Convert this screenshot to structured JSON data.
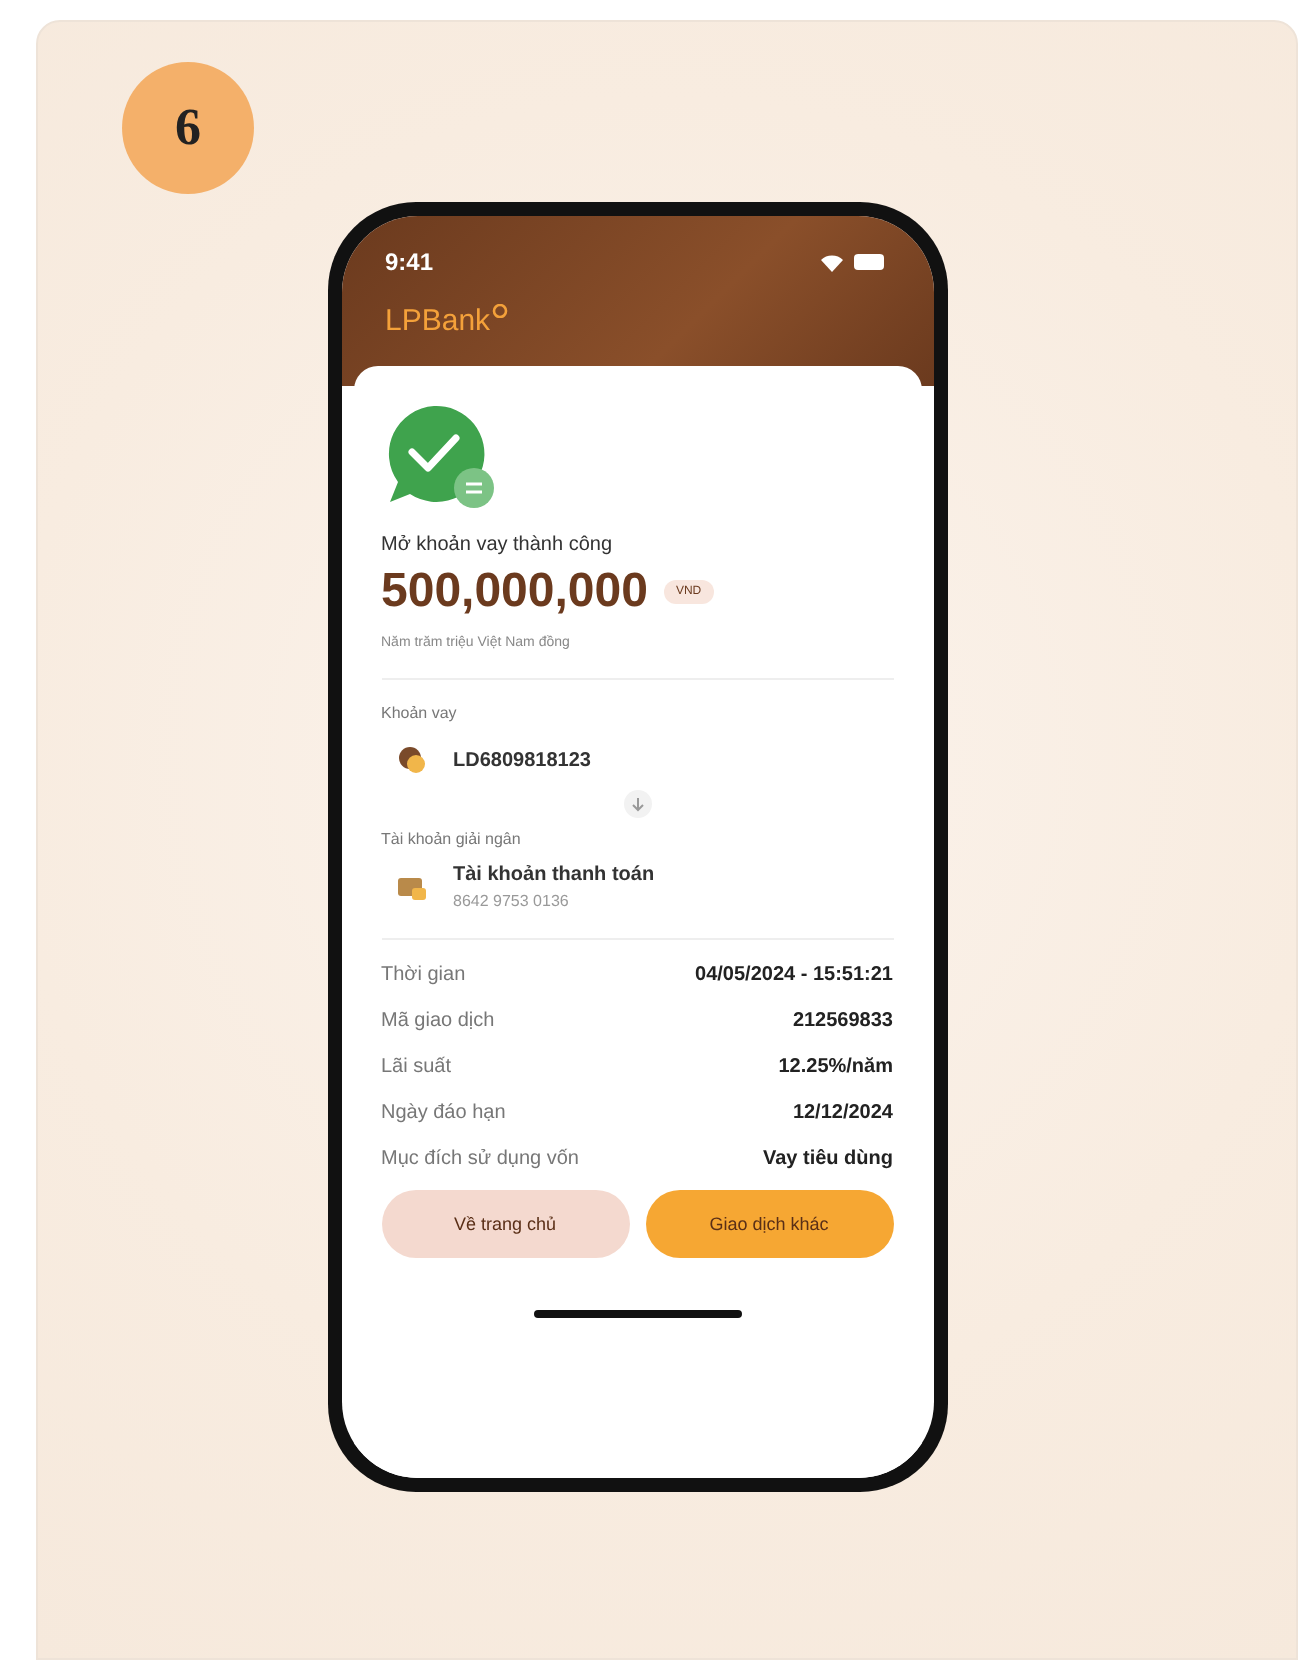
{
  "step_badge": "6",
  "status_bar": {
    "time": "9:41"
  },
  "header": {
    "logo": "LPBank"
  },
  "result": {
    "title": "Mở khoản vay thành công",
    "amount": "500,000,000",
    "currency": "VND",
    "amount_in_words": "Năm trăm triệu Việt Nam đồng"
  },
  "loan": {
    "label": "Khoản vay",
    "number": "LD6809818123"
  },
  "disbursement_account": {
    "label": "Tài khoản giải ngân",
    "name": "Tài khoản thanh toán",
    "number": "8642 9753 0136"
  },
  "details": [
    {
      "label": "Thời gian",
      "value": "04/05/2024 - 15:51:21"
    },
    {
      "label": "Mã giao dịch",
      "value": "212569833"
    },
    {
      "label": "Lãi suất",
      "value": "12.25%/năm"
    },
    {
      "label": "Ngày đáo hạn",
      "value": "12/12/2024"
    },
    {
      "label": "Mục đích sử dụng vốn",
      "value": "Vay tiêu dùng"
    }
  ],
  "buttons": [
    {
      "label": "Về trang chủ",
      "kind": "secondary"
    },
    {
      "label": "Giao dịch khác",
      "kind": "primary"
    }
  ]
}
